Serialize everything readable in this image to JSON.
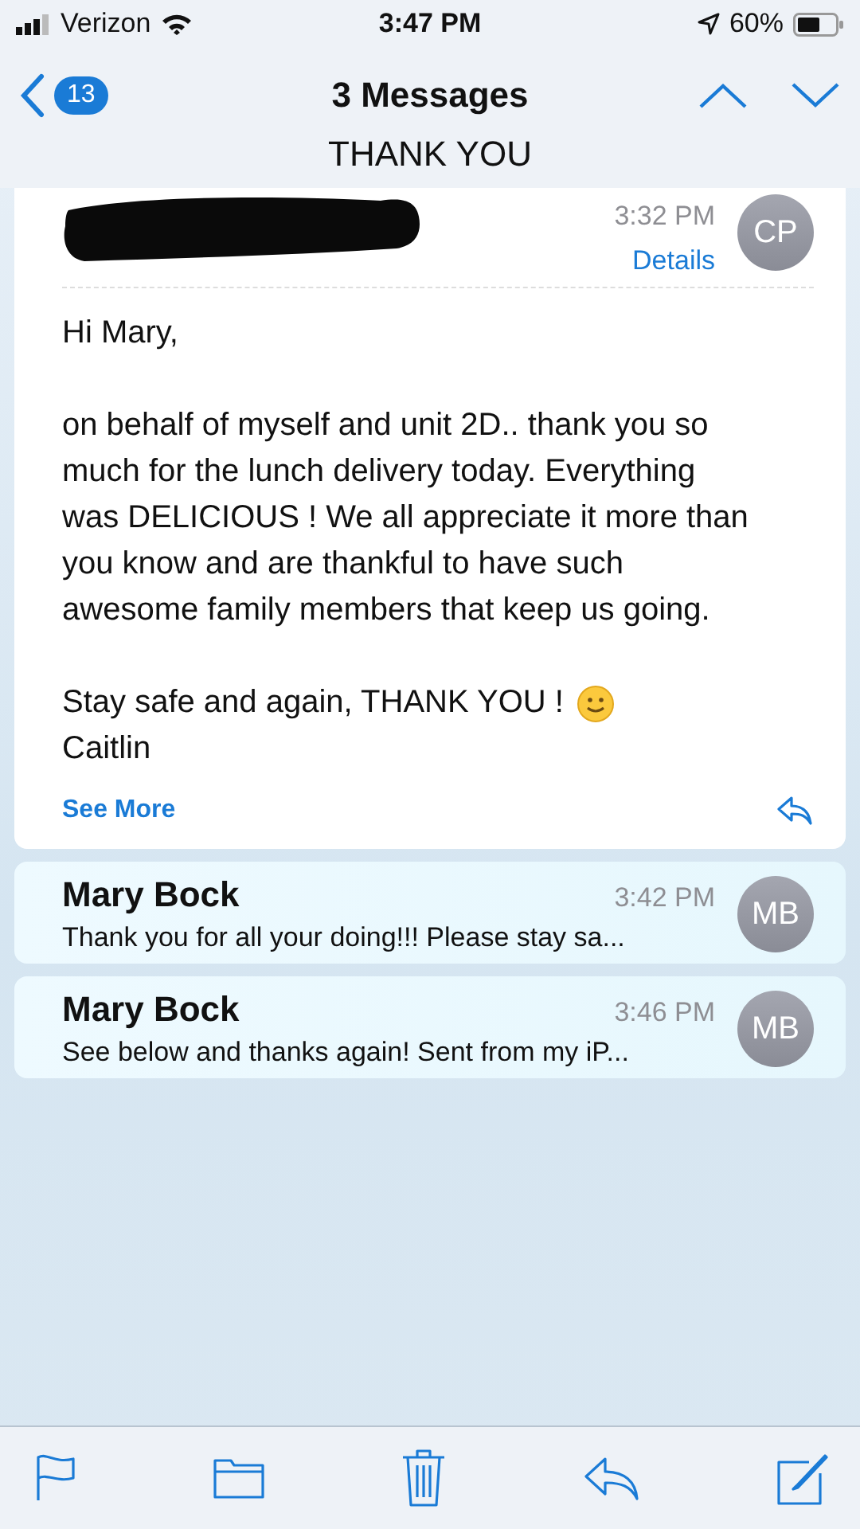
{
  "status_bar": {
    "carrier": "Verizon",
    "time": "3:47 PM",
    "battery": "60%"
  },
  "nav": {
    "unread_count": "13",
    "title": "3 Messages",
    "subject": "THANK YOU"
  },
  "messages": [
    {
      "kind": "expanded",
      "time": "3:32 PM",
      "initials": "CP",
      "details_link": "Details",
      "greeting": "Hi Mary,",
      "paragraph": "on behalf of myself and unit 2D.. thank you so much for the lunch delivery today. Everything was DELICIOUS ! We all appreciate it more than you know and are thankful to have such awesome family members that keep us going.",
      "closing": "Stay safe and again, THANK YOU !",
      "signature": "Caitlin",
      "see_more": "See More"
    },
    {
      "kind": "summary",
      "sender": "Mary Bock",
      "time": "3:42 PM",
      "preview": "Thank you for all your doing!!! Please stay sa...",
      "initials": "MB"
    },
    {
      "kind": "summary",
      "sender": "Mary Bock",
      "time": "3:46 PM",
      "preview": "See below and thanks again! Sent from my iP...",
      "initials": "MB"
    }
  ]
}
